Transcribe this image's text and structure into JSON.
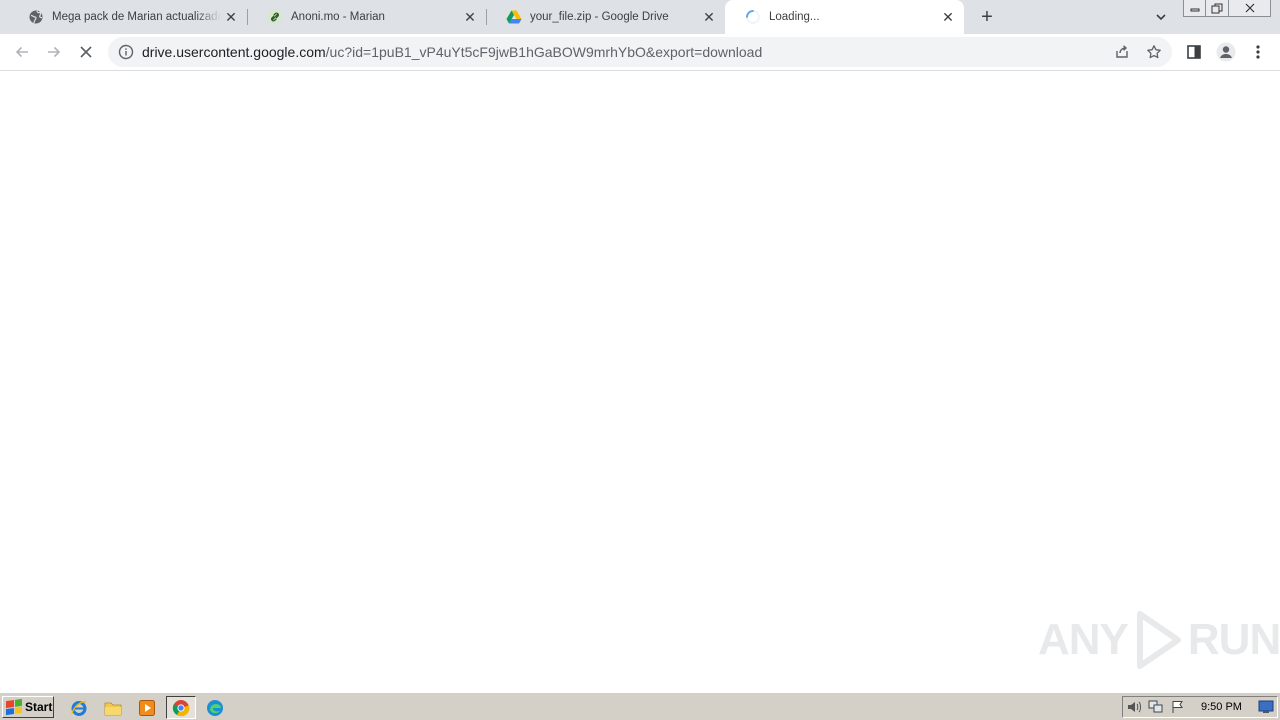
{
  "tabs": [
    {
      "title": "Mega pack de Marian actualizado con",
      "favicon": "globe-icon"
    },
    {
      "title": "Anoni.mo - Marian",
      "favicon": "link-icon"
    },
    {
      "title": "your_file.zip - Google Drive",
      "favicon": "google-drive-icon"
    },
    {
      "title": "Loading...",
      "favicon": "loading-spinner-icon",
      "active": true
    }
  ],
  "toolbar": {
    "url_host": "drive.usercontent.google.com",
    "url_path": "/uc?id=1puB1_vP4uYt5cF9jwB1hGaBOW9mrhYbO&export=download"
  },
  "watermark": {
    "text_left": "ANY",
    "text_right": "RUN"
  },
  "taskbar": {
    "start_label": "Start",
    "clock": "9:50 PM"
  },
  "colors": {
    "tabstrip": "#dee1e6",
    "omnibox": "#f1f3f4",
    "taskbar": "#d4d0c8",
    "accent_blue": "#1a73e8"
  }
}
